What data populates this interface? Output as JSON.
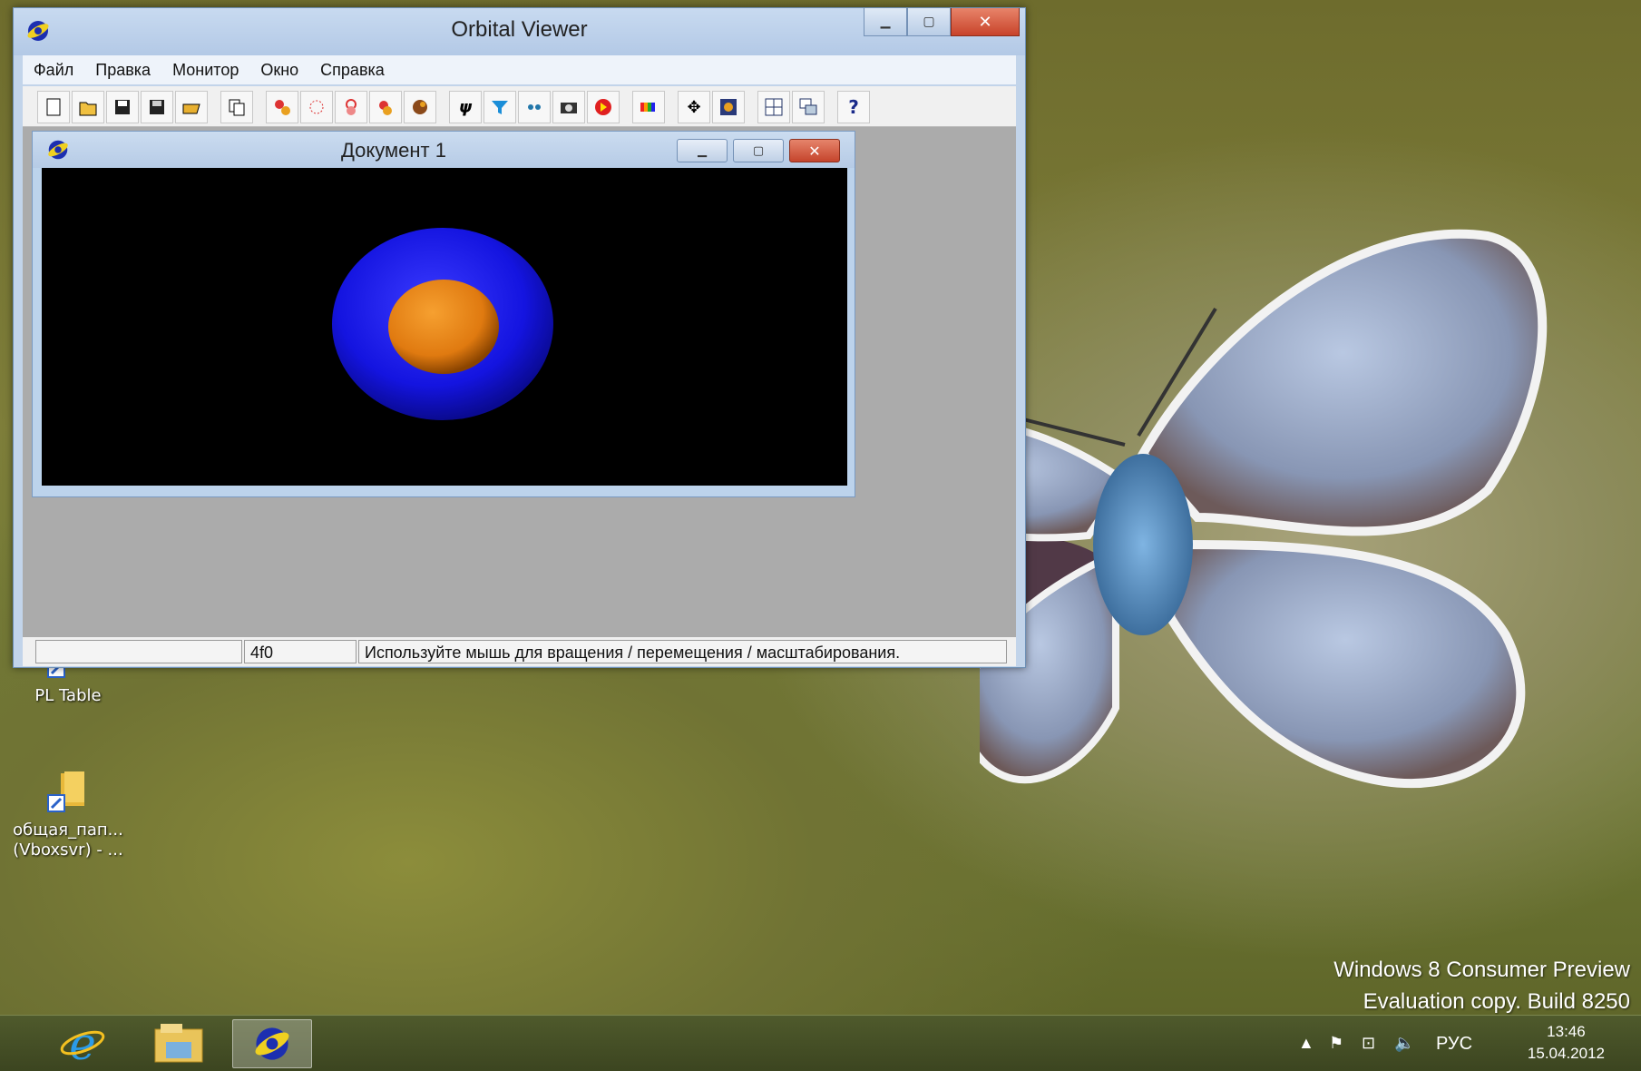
{
  "window": {
    "title": "Orbital Viewer",
    "menu": [
      "Файл",
      "Правка",
      "Монитор",
      "Окно",
      "Справка"
    ],
    "toolbar_icons": [
      "new-icon",
      "open-icon",
      "save-icon",
      "save-as-icon",
      "folder-open-icon",
      "copy-icon",
      "orbital-red-icon",
      "orbital-grid-icon",
      "orbital-pink-icon",
      "orbital-yellow-icon",
      "orbital-brown-icon",
      "psi-icon",
      "funnel-icon",
      "arrows-icon",
      "camera-icon",
      "record-icon",
      "spectrum-icon",
      "move-icon",
      "display-icon",
      "tile-icon",
      "cascade-icon",
      "help-icon"
    ],
    "status": {
      "panel1": "",
      "panel2": "4f0",
      "panel3": "Используйте мышь для вращения / перемещения / масштабирования."
    }
  },
  "document": {
    "title": "Документ 1"
  },
  "desktop": {
    "icons": [
      {
        "label": "PL Table"
      },
      {
        "label_line1": "общая_пап...",
        "label_line2": "(Vboxsvr) - ..."
      }
    ],
    "watermark_line1": "Windows 8 Consumer Preview",
    "watermark_line2": "Evaluation copy. Build 8250"
  },
  "taskbar": {
    "apps": [
      "internet-explorer-icon",
      "file-explorer-icon",
      "orbital-viewer-icon"
    ],
    "language": "РУС",
    "time": "13:46",
    "date": "15.04.2012"
  },
  "colors": {
    "orbital_ring": "#1a1aff",
    "orbital_core": "#e07a10",
    "viewport_bg": "#000000"
  }
}
